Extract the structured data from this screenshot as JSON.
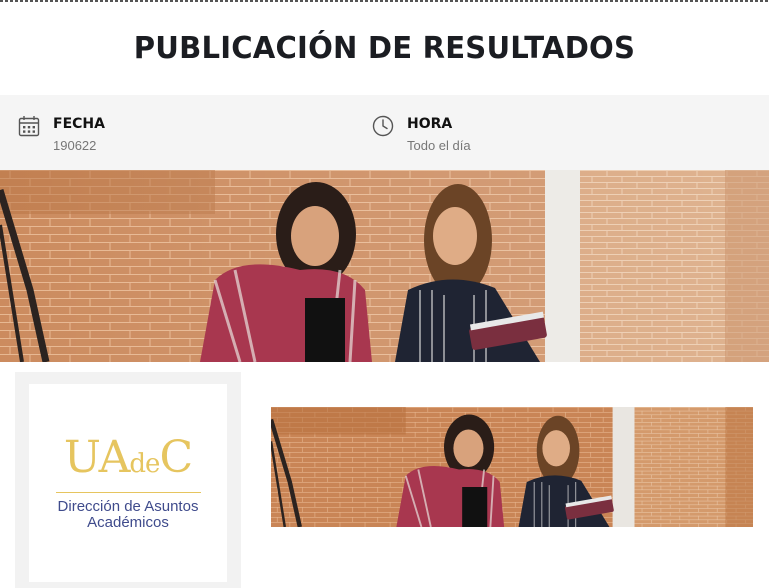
{
  "page": {
    "title": "PUBLICACIÓN DE RESULTADOS"
  },
  "event_info": {
    "date": {
      "label": "FECHA",
      "value": "190622",
      "icon": "calendar-icon"
    },
    "time": {
      "label": "HORA",
      "value": "Todo el día",
      "icon": "clock-icon"
    }
  },
  "hero_image": {
    "description": "two-students-on-stairs-photo"
  },
  "logo": {
    "mark_big_1": "UA",
    "mark_small": "de",
    "mark_big_2": "C",
    "line1": "Dirección de Asuntos",
    "line2": "Académicos",
    "brand_gold": "#e6c55f",
    "brand_blue": "#3f4b8c"
  },
  "thumbnail_image": {
    "description": "two-students-on-stairs-photo-thumbnail"
  }
}
